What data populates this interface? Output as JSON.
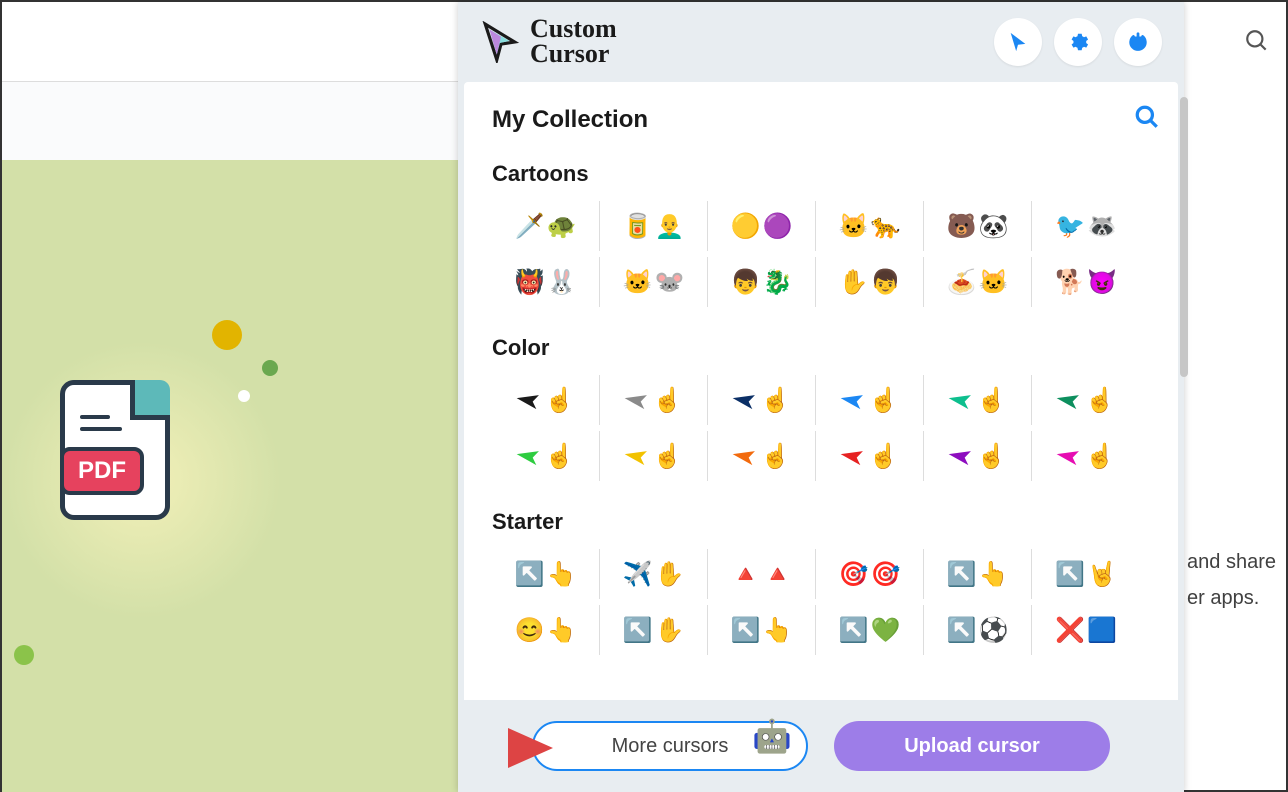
{
  "background": {
    "pdf_label": "PDF",
    "right_text_1": "and share",
    "right_text_2": "er apps."
  },
  "popup": {
    "logo_line1": "Custom",
    "logo_line2": "Cursor",
    "collection_title": "My Collection",
    "sections": [
      {
        "title": "Cartoons",
        "items": [
          {
            "name": "tmnt",
            "emoji1": "🗡️",
            "emoji2": "🐢"
          },
          {
            "name": "popeye",
            "emoji1": "🥫",
            "emoji2": "👨‍🦲"
          },
          {
            "name": "minion",
            "emoji1": "🟡",
            "emoji2": "🟣"
          },
          {
            "name": "felix",
            "emoji1": "🐱",
            "emoji2": "🐆"
          },
          {
            "name": "bears",
            "emoji1": "🐻",
            "emoji2": "🐼"
          },
          {
            "name": "regular",
            "emoji1": "🐦",
            "emoji2": "🦝"
          },
          {
            "name": "shrek",
            "emoji1": "👹",
            "emoji2": "🐰"
          },
          {
            "name": "tomjerry",
            "emoji1": "🐱",
            "emoji2": "🐭"
          },
          {
            "name": "dragon",
            "emoji1": "👦",
            "emoji2": "🐉"
          },
          {
            "name": "ben10",
            "emoji1": "✋",
            "emoji2": "👦"
          },
          {
            "name": "garfield",
            "emoji1": "🍝",
            "emoji2": "🐱"
          },
          {
            "name": "grinch",
            "emoji1": "🐕",
            "emoji2": "😈"
          }
        ]
      },
      {
        "title": "Color",
        "items": [
          {
            "name": "black",
            "color": "#1a1a1a"
          },
          {
            "name": "gray",
            "color": "#8a8a8a"
          },
          {
            "name": "navy",
            "color": "#0b2f66"
          },
          {
            "name": "blue",
            "color": "#1b87f3"
          },
          {
            "name": "cyan",
            "color": "#0dbf8e"
          },
          {
            "name": "darkgreen",
            "color": "#0d8f5e"
          },
          {
            "name": "green",
            "color": "#2ecc40"
          },
          {
            "name": "yellow",
            "color": "#f2c200"
          },
          {
            "name": "orange",
            "color": "#f26a0d"
          },
          {
            "name": "red",
            "color": "#e62222"
          },
          {
            "name": "purple",
            "color": "#8d0dbf"
          },
          {
            "name": "magenta",
            "color": "#e60db2"
          }
        ]
      },
      {
        "title": "Starter",
        "items": [
          {
            "name": "holo",
            "emoji1": "↖️",
            "emoji2": "👆"
          },
          {
            "name": "paper",
            "emoji1": "✈️",
            "emoji2": "✋"
          },
          {
            "name": "stone",
            "emoji1": "🔺",
            "emoji2": "🔺"
          },
          {
            "name": "target",
            "emoji1": "🎯",
            "emoji2": "🎯"
          },
          {
            "name": "outline",
            "emoji1": "↖️",
            "emoji2": "👆"
          },
          {
            "name": "rock",
            "emoji1": "↖️",
            "emoji2": "🤘"
          },
          {
            "name": "smiley",
            "emoji1": "😊",
            "emoji2": "👆"
          },
          {
            "name": "rainbow",
            "emoji1": "↖️",
            "emoji2": "✋"
          },
          {
            "name": "glass",
            "emoji1": "↖️",
            "emoji2": "👆"
          },
          {
            "name": "splat",
            "emoji1": "↖️",
            "emoji2": "💚"
          },
          {
            "name": "soccer",
            "emoji1": "↖️",
            "emoji2": "⚽"
          },
          {
            "name": "pixel",
            "emoji1": "❌",
            "emoji2": "🟦"
          }
        ]
      }
    ],
    "footer": {
      "more_label": "More cursors",
      "upload_label": "Upload cursor"
    }
  }
}
